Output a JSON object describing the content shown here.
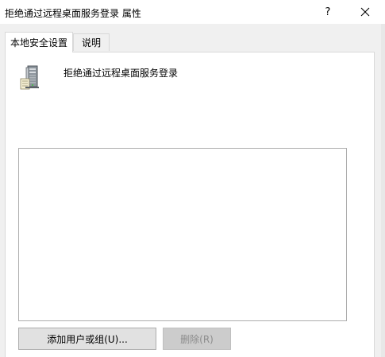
{
  "window": {
    "title": "拒绝通过远程桌面服务登录 属性",
    "help_label": "?",
    "close_icon": "close-icon"
  },
  "tabs": [
    {
      "label": "本地安全设置",
      "active": true
    },
    {
      "label": "说明",
      "active": false
    }
  ],
  "policy": {
    "icon": "server-icon",
    "name": "拒绝通过远程桌面服务登录"
  },
  "members_list": {
    "items": []
  },
  "buttons": {
    "add_label": "添加用户或组(U)...",
    "remove_label": "删除(R)",
    "remove_disabled": true
  },
  "colors": {
    "titlebar_bg": "#ffffff",
    "window_bg": "#f0f0f0",
    "panel_bg": "#ffffff",
    "button_bg": "#e1e1e1",
    "disabled_text": "#8c8c8c"
  }
}
